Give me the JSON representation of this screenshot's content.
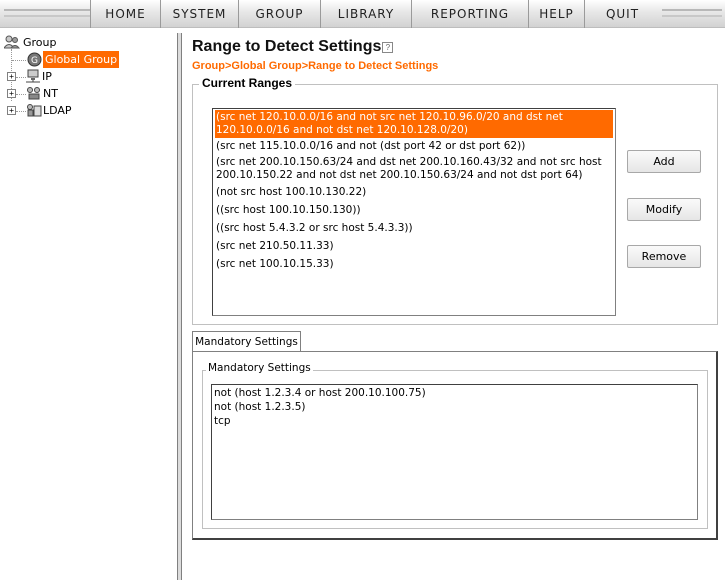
{
  "nav": {
    "items": [
      "HOME",
      "SYSTEM",
      "GROUP",
      "LIBRARY",
      "REPORTING",
      "HELP",
      "QUIT"
    ]
  },
  "tree": {
    "root": "Group",
    "selected": "Global Group",
    "items": [
      "IP",
      "NT",
      "LDAP"
    ],
    "selected_color": "#ff6a00"
  },
  "page": {
    "title": "Range to Detect Settings",
    "help_glyph": "?",
    "breadcrumb": "Group>Global Group>Range to Detect Settings",
    "accent": "#ff6a00"
  },
  "current_ranges": {
    "legend": "Current Ranges",
    "items": [
      "(src net 120.10.0.0/16 and not src net 120.10.96.0/20 and dst net 120.10.0.0/16 and not dst net 120.10.128.0/20)",
      "(src net 115.10.0.0/16 and not (dst port 42 or dst port 62))",
      "(src net 200.10.150.63/24 and dst net 200.10.160.43/32 and not src host 200.10.150.22 and not dst net 200.10.150.63/24 and not dst port 64)",
      "(not src host 100.10.130.22)",
      "((src host 100.10.150.130))",
      "((src host 5.4.3.2 or src host 5.4.3.3))",
      "(src net 210.50.11.33)",
      "(src net 100.10.15.33)"
    ],
    "selected_index": 0
  },
  "buttons": {
    "add": "Add",
    "modify": "Modify",
    "remove": "Remove"
  },
  "mandatory": {
    "tab_label": "Mandatory Settings",
    "legend": "Mandatory Settings",
    "lines": [
      "not (host 1.2.3.4 or host 200.10.100.75)",
      "not (host 1.2.3.5)",
      "tcp"
    ]
  }
}
